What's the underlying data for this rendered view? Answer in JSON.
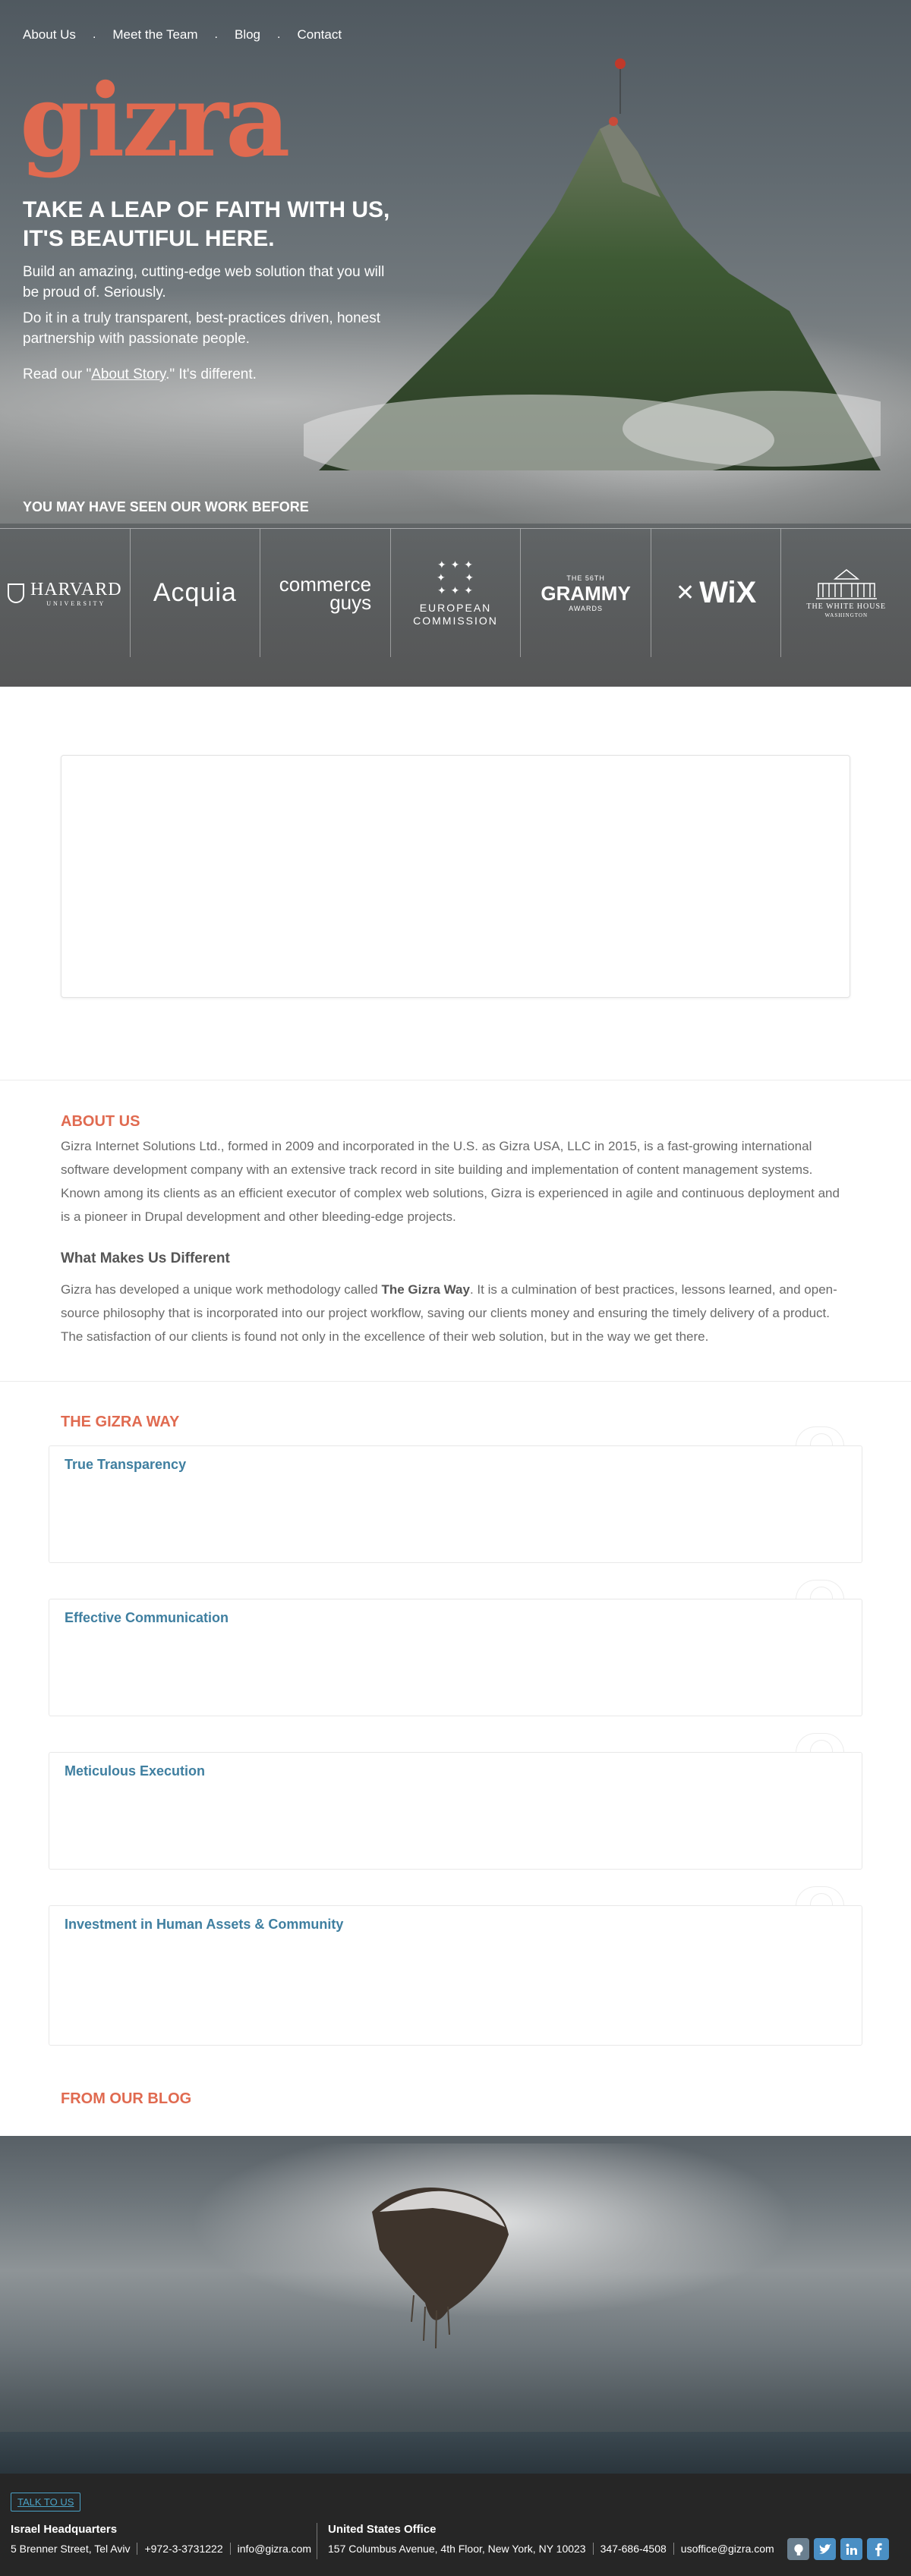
{
  "nav": {
    "items": [
      "About Us",
      "Meet the Team",
      "Blog",
      "Contact"
    ],
    "separator": "."
  },
  "brand": {
    "logo_text": "gizra",
    "accent": "#e06a50"
  },
  "hero": {
    "headline_1": "TAKE A LEAP OF FAITH WITH US,",
    "headline_2": "IT'S BEAUTIFUL HERE.",
    "intro_1": "Build an amazing, cutting-edge web solution that you will be proud of. Seriously.",
    "intro_2": "Do it in a truly transparent, best-practices driven, honest partnership with passionate people.",
    "intro_3_prefix": "Read our \"",
    "intro_3_link": "About Story",
    "intro_3_suffix": ".\" It's different."
  },
  "clients": {
    "title": "YOU MAY HAVE SEEN OUR WORK BEFORE",
    "logos": {
      "harvard": "HARVARD",
      "harvard_sub": "UNIVERSITY",
      "acquia": "Acquia",
      "cg_1": "commerce",
      "cg_2": "guys",
      "ec_1": "EUROPEAN",
      "ec_2": "COMMISSION",
      "grammy_pre": "THE 56TH",
      "grammy": "GRAMMY",
      "grammy_post": "AWARDS",
      "wix": "WiX",
      "wh_1": "THE WHITE HOUSE",
      "wh_2": "WASHINGTON"
    }
  },
  "about": {
    "title": "ABOUT US",
    "text": "Gizra Internet Solutions Ltd., formed in 2009 and incorporated in the U.S. as Gizra USA, LLC in 2015, is a fast-growing international software development company with an extensive track record in site building and implementation of content management systems. Known among its clients as an efficient executor of complex web solutions, Gizra is experienced in agile and continuous deployment and is a pioneer in Drupal development and other bleeding-edge projects.",
    "subtitle": "What Makes Us Different",
    "text2_prefix": "Gizra has developed a unique work methodology called ",
    "text2_bold": "The Gizra Way",
    "text2_suffix": ". It is a culmination of best practices, lessons learned, and open-source philosophy that is incorporated into our project workflow, saving our clients money and ensuring the timely delivery of a product. The satisfaction of our clients is found not only in the excellence of their web solution, but in the way we get there."
  },
  "way": {
    "title": "THE GIZRA WAY",
    "cards": [
      "True Transparency",
      "Effective Communication",
      "Meticulous Execution",
      "Investment in Human Assets & Community"
    ]
  },
  "blog": {
    "title": "FROM OUR BLOG"
  },
  "footer": {
    "talk": "TALK TO US",
    "israel": {
      "title": "Israel Headquarters",
      "address": "5 Brenner Street, Tel Aviv",
      "phone": "+972-3-3731222",
      "email": "info@gizra.com"
    },
    "us": {
      "title": "United States Office",
      "address": "157 Columbus Avenue, 4th Floor, New York, NY 10023",
      "phone": "347-686-4508",
      "email": "usoffice@gizra.com"
    },
    "social_icons": [
      "github-icon",
      "twitter-icon",
      "linkedin-icon",
      "facebook-icon"
    ],
    "social_color": "#4a8fc4"
  }
}
